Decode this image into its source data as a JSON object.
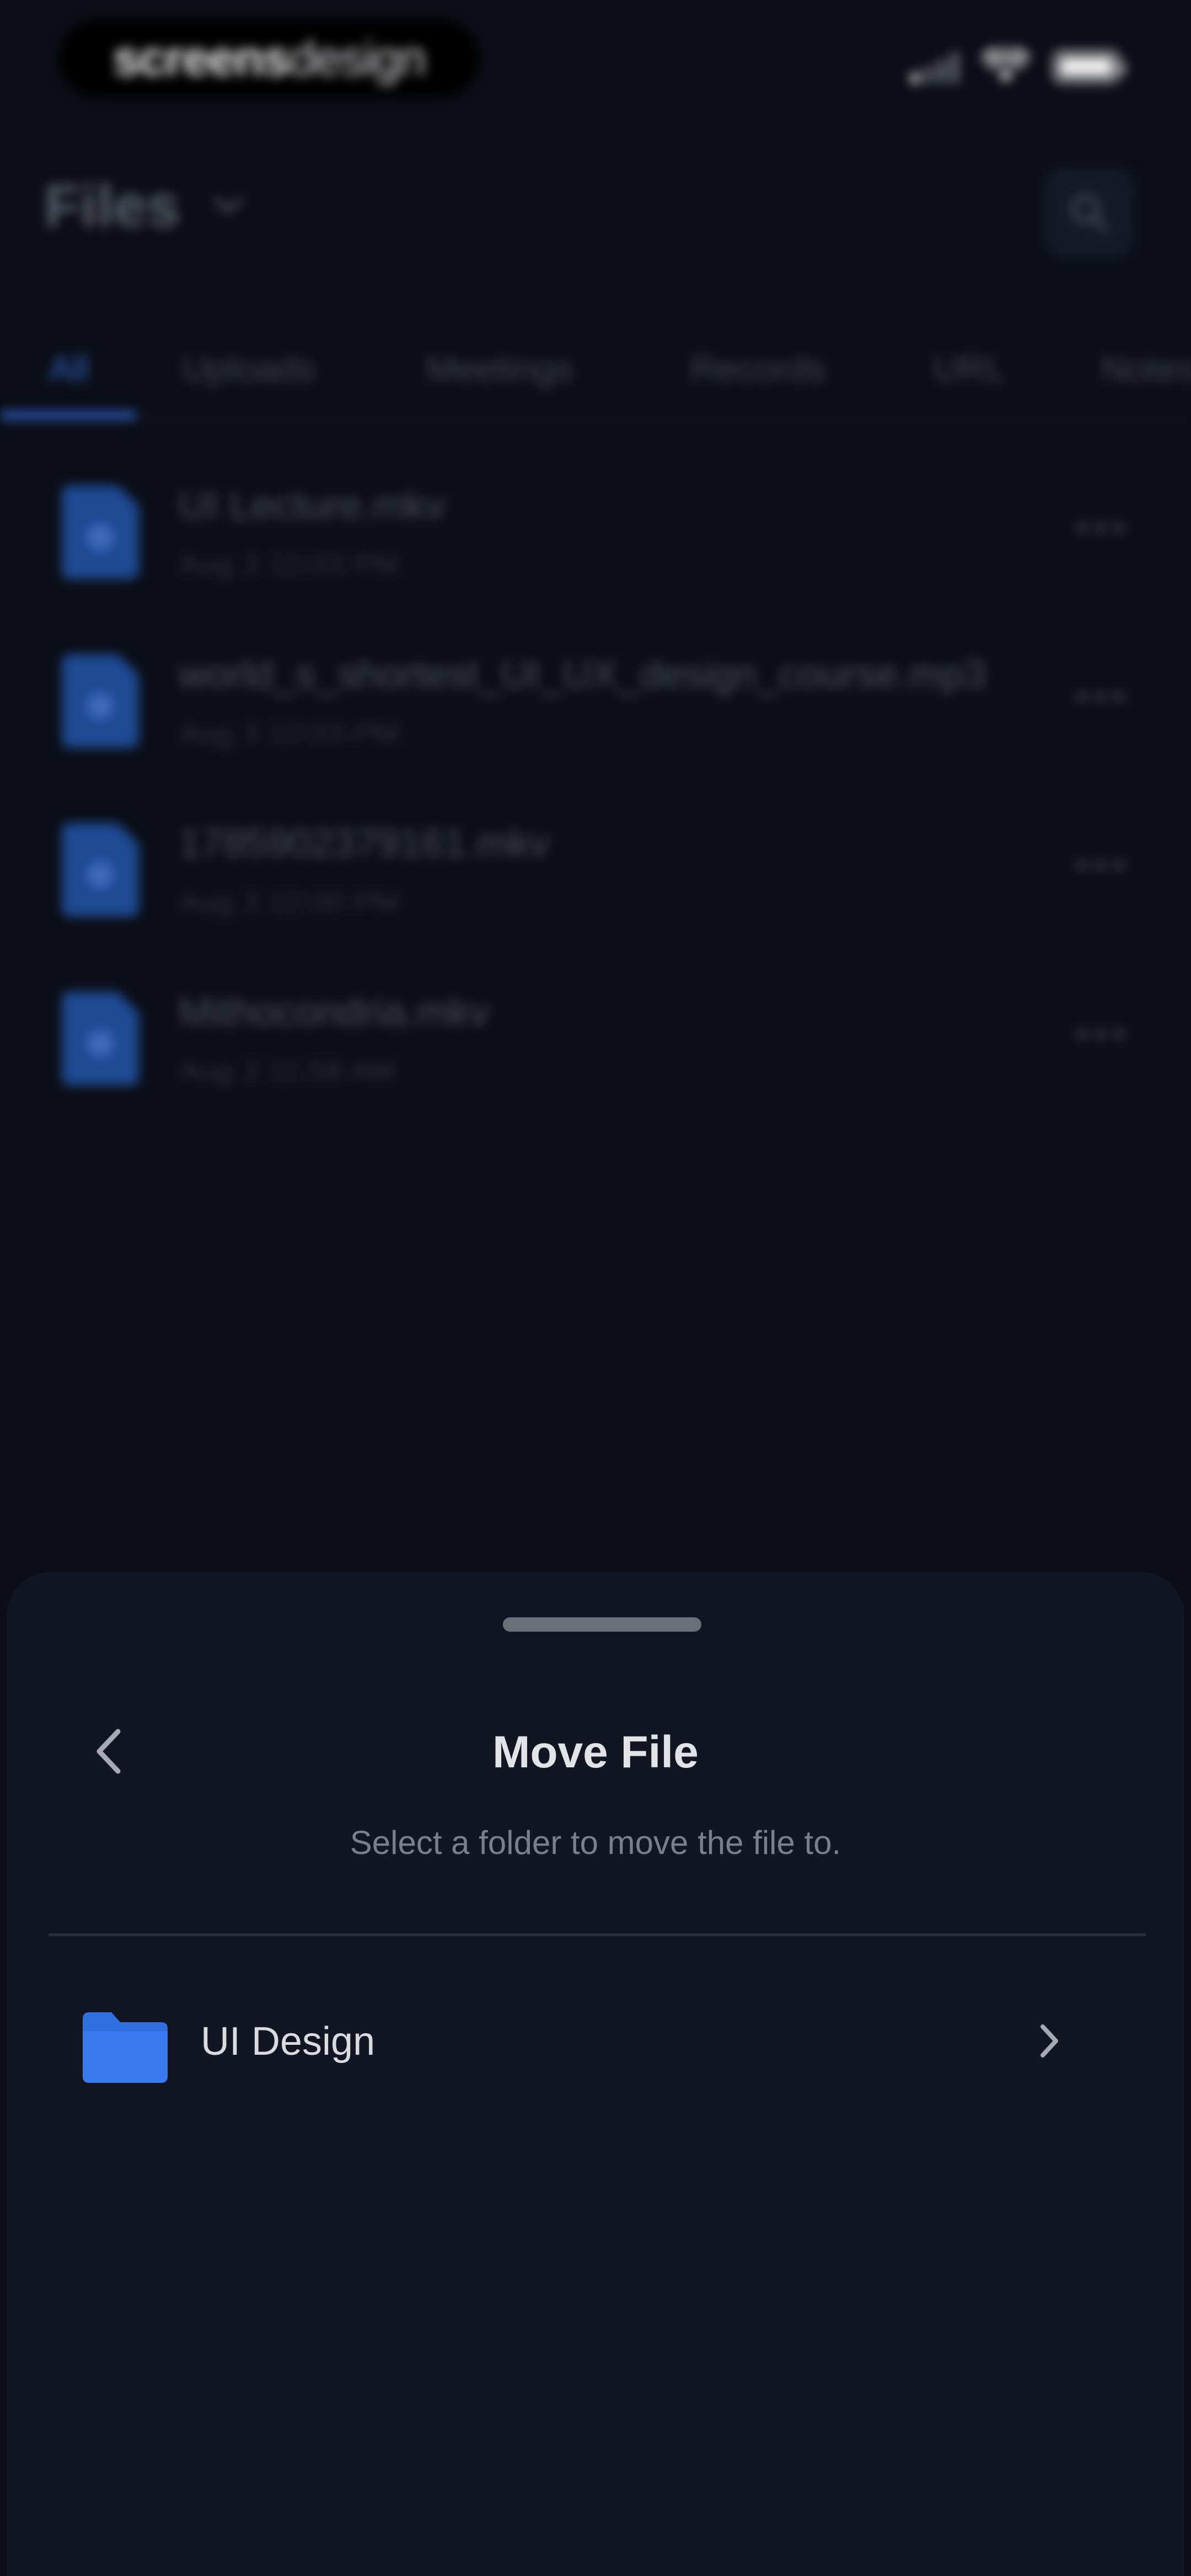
{
  "status_bar": {
    "watermark_bold": "screens",
    "watermark_light": "design"
  },
  "header": {
    "title": "Files"
  },
  "tabs": [
    {
      "label": "All",
      "active": true
    },
    {
      "label": "Uploads",
      "active": false
    },
    {
      "label": "Meetings",
      "active": false
    },
    {
      "label": "Records",
      "active": false
    },
    {
      "label": "URL",
      "active": false
    },
    {
      "label": "Notes",
      "active": false
    }
  ],
  "files": [
    {
      "name": "UI Lecture.mkv",
      "date": "Aug 3 12:03 PM"
    },
    {
      "name": "world_s_shortest_UI_UX_design_course.mp3",
      "date": "Aug 3 12:03 PM"
    },
    {
      "name": "1785902379161.mkv",
      "date": "Aug 3 12:00 PM"
    },
    {
      "name": "Mithocondria.mkv",
      "date": "Aug 3 11:58 AM"
    }
  ],
  "sheet": {
    "title": "Move File",
    "subtitle": "Select a folder to move the file to.",
    "folders": [
      {
        "name": "UI Design"
      }
    ]
  },
  "colors": {
    "accent": "#2f6fe0",
    "background": "#0b0e16",
    "sheet": "#121623"
  },
  "icons": {
    "search": "search-icon",
    "back": "chevron-left-icon",
    "folder": "folder-icon",
    "forward": "chevron-right-icon",
    "more": "more-horizontal-icon"
  }
}
